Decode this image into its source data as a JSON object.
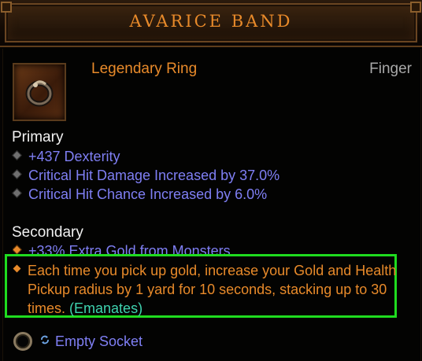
{
  "item": {
    "name": "AVARICE BAND",
    "type": "Legendary Ring",
    "slot": "Finger"
  },
  "primary": {
    "title": "Primary",
    "stats": [
      "+437 Dexterity",
      "Critical Hit Damage Increased by 37.0%",
      "Critical Hit Chance Increased by 6.0%"
    ]
  },
  "secondary": {
    "title": "Secondary",
    "stats": [
      "+33% Extra Gold from Monsters"
    ]
  },
  "legendary_power": {
    "text": "Each time you pick up gold, increase your Gold and Health Pickup radius by 1 yard for 10 seconds, stacking up to 30 times.",
    "tag": "(Emanates)"
  },
  "socket": {
    "label": "Empty Socket"
  },
  "colors": {
    "legendary": "#e88a2a",
    "magic_affix": "#7f7ff4",
    "highlight_border": "#1fdc1f",
    "emanates": "#3fd4b0"
  }
}
